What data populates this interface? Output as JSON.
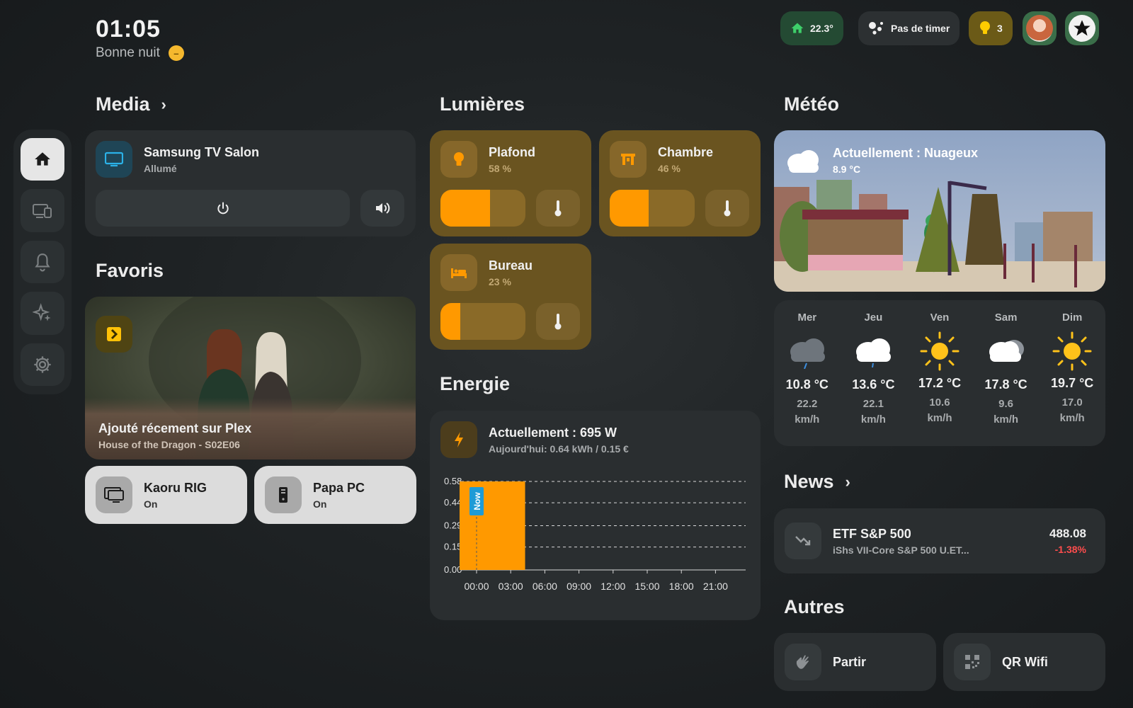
{
  "header": {
    "time": "01:05",
    "greeting": "Bonne nuit",
    "temperature": "22.3°",
    "timer": "Pas de timer",
    "lights_on": "3"
  },
  "sections": {
    "media": "Media",
    "lights": "Lumières",
    "weather": "Météo",
    "favorites": "Favoris",
    "energy": "Energie",
    "news": "News",
    "others": "Autres"
  },
  "media": {
    "device": "Samsung TV Salon",
    "state": "Allumé"
  },
  "lights": [
    {
      "name": "Plafond",
      "level": "58 %",
      "fraction": 0.58
    },
    {
      "name": "Chambre",
      "level": "46 %",
      "fraction": 0.46
    },
    {
      "name": "Bureau",
      "level": "23 %",
      "fraction": 0.23
    }
  ],
  "favorites": {
    "plex_title": "Ajouté récement sur Plex",
    "plex_subtitle": "House of the Dragon - S02E06",
    "devices": [
      {
        "name": "Kaoru RIG",
        "state": "On"
      },
      {
        "name": "Papa PC",
        "state": "On"
      }
    ]
  },
  "energy": {
    "current": "Actuellement : 695 W",
    "today": "Aujourd'hui: 0.64 kWh / 0.15 €",
    "now_label": "Now"
  },
  "chart_data": {
    "type": "bar",
    "categories": [
      "00:00",
      "03:00",
      "06:00",
      "09:00",
      "12:00",
      "15:00",
      "18:00",
      "21:00"
    ],
    "values": [
      0.58,
      0,
      0,
      0,
      0,
      0,
      0,
      0
    ],
    "yticks": [
      "0.00",
      "0.15",
      "0.29",
      "0.44",
      "0.58"
    ],
    "ylim": [
      0,
      0.58
    ],
    "grid": true,
    "color": "#ff9900"
  },
  "weather": {
    "current": "Actuellement : Nuageux",
    "temp": "8.9 °C",
    "forecast": [
      {
        "day": "Mer",
        "icon": "rain-cloud-icon",
        "temp": "10.8 °C",
        "wind": "22.2",
        "unit": "km/h"
      },
      {
        "day": "Jeu",
        "icon": "cloud-drizzle-icon",
        "temp": "13.6 °C",
        "wind": "22.1",
        "unit": "km/h"
      },
      {
        "day": "Ven",
        "icon": "sun-icon",
        "temp": "17.2 °C",
        "wind": "10.6",
        "unit": "km/h"
      },
      {
        "day": "Sam",
        "icon": "cloud-icon",
        "temp": "17.8 °C",
        "wind": "9.6",
        "unit": "km/h"
      },
      {
        "day": "Dim",
        "icon": "sun-icon",
        "temp": "19.7 °C",
        "wind": "17.0",
        "unit": "km/h"
      }
    ]
  },
  "news": {
    "ticker": "ETF S&P 500",
    "name": "iShs VII-Core S&P 500 U.ET...",
    "price": "488.08",
    "change": "-1.38%"
  },
  "others": [
    {
      "name": "Partir"
    },
    {
      "name": "QR Wifi"
    }
  ],
  "colors": {
    "accent": "#ff9900",
    "light_card": "#6a5420",
    "negative": "#ff4d4d"
  }
}
